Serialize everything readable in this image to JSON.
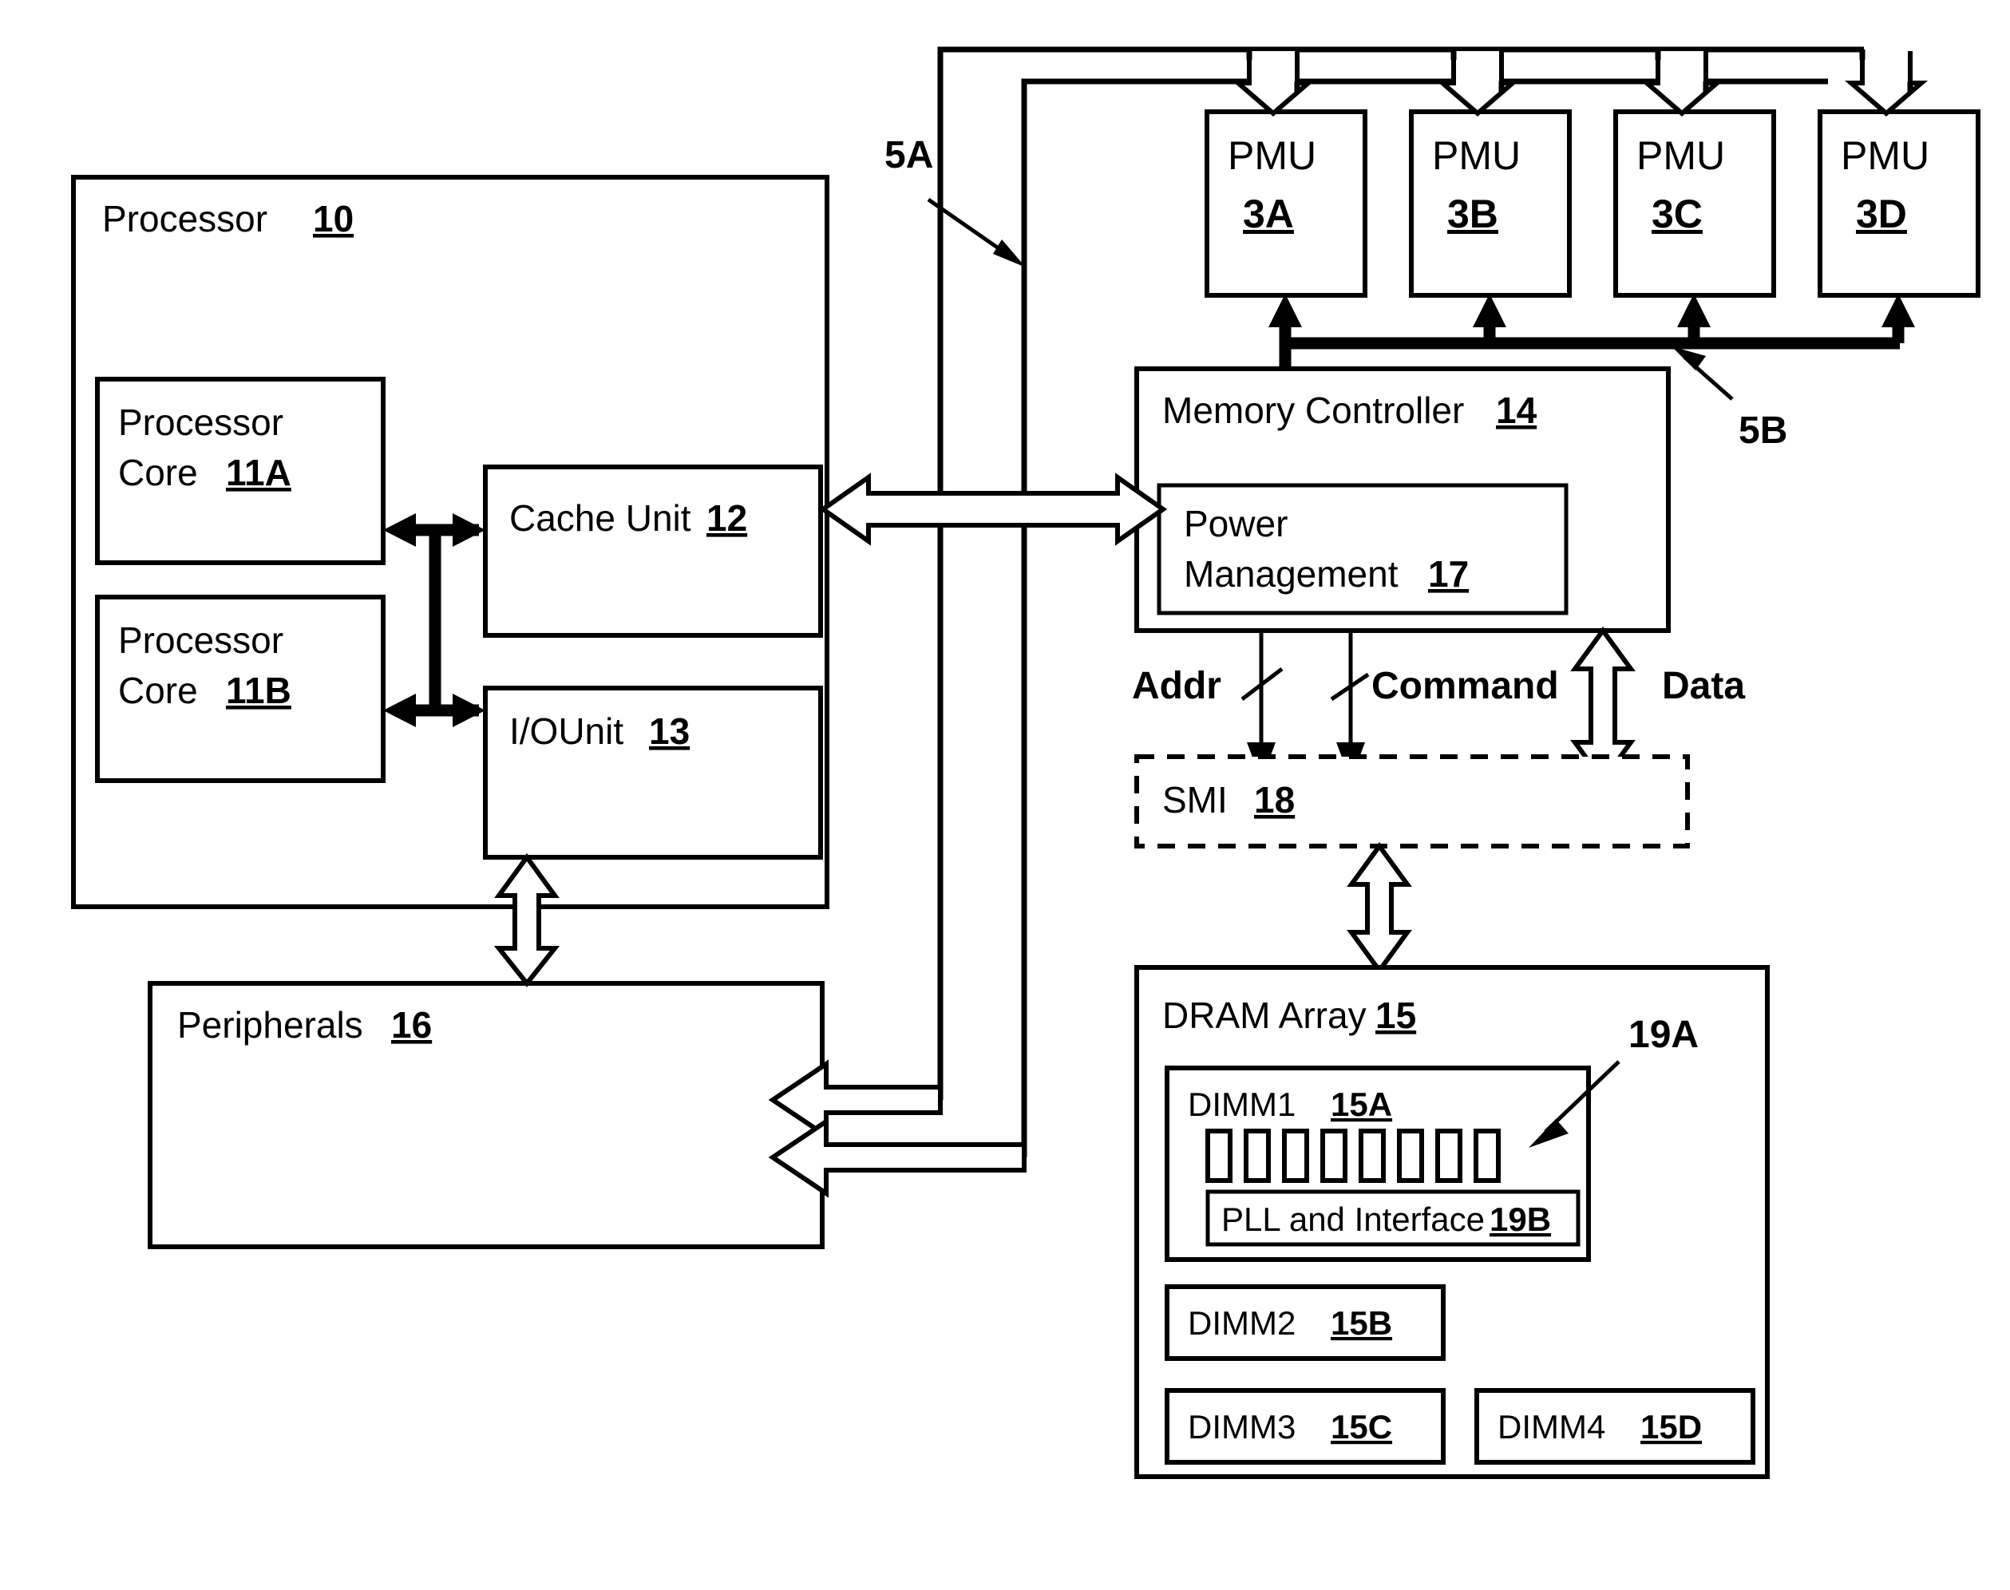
{
  "figure": {
    "type": "patent-block-diagram",
    "background_color": "#ffffff",
    "line_color": "#000000"
  },
  "processor": {
    "title": "Processor",
    "ref": "10",
    "core_a": {
      "line1": "Processor",
      "line2": "Core",
      "ref": "11A"
    },
    "core_b": {
      "line1": "Processor",
      "line2": "Core",
      "ref": "11B"
    },
    "cache": {
      "label": "Cache Unit",
      "ref": "12"
    },
    "io": {
      "label": "I/OUnit",
      "ref": "13"
    }
  },
  "peripherals": {
    "label": "Peripherals",
    "ref": "16"
  },
  "pmus": [
    {
      "label": "PMU",
      "ref": "3A"
    },
    {
      "label": "PMU",
      "ref": "3B"
    },
    {
      "label": "PMU",
      "ref": "3C"
    },
    {
      "label": "PMU",
      "ref": "3D"
    }
  ],
  "memory_controller": {
    "label": "Memory Controller",
    "ref": "14",
    "power_management": {
      "line1": "Power",
      "line2": "Management",
      "ref": "17"
    }
  },
  "smi": {
    "label": "SMI",
    "ref": "18"
  },
  "signals": {
    "addr": "Addr",
    "command": "Command",
    "data": "Data"
  },
  "buses": {
    "bus_5a": "5A",
    "bus_5b": "5B"
  },
  "dram_array": {
    "label": "DRAM Array",
    "ref": "15",
    "dimm1": {
      "label": "DIMM1",
      "ref": "15A",
      "chip_count": 8,
      "chips_callout": "19A",
      "pll": {
        "label": "PLL and Interface",
        "ref": "19B"
      }
    },
    "dimm2": {
      "label": "DIMM2",
      "ref": "15B"
    },
    "dimm3": {
      "label": "DIMM3",
      "ref": "15C"
    },
    "dimm4": {
      "label": "DIMM4",
      "ref": "15D"
    }
  }
}
